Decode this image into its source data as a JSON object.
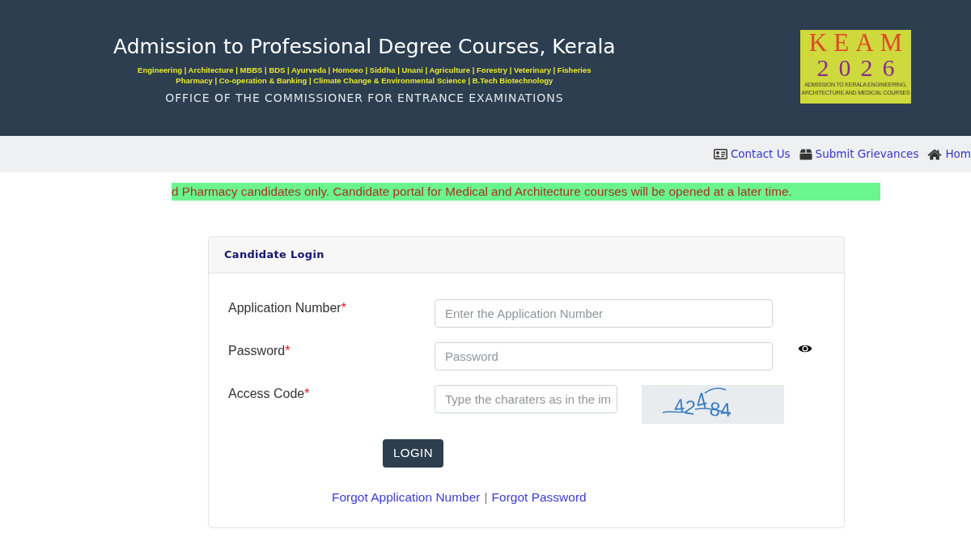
{
  "header": {
    "title": "Admission to Professional Degree Courses, Kerala",
    "course_lines": [
      "Engineering | Architecture | MBBS | BDS | Ayurveda | Homoeo | Siddha | Unani | Agriculture | Forestry | Veterinary | Fisheries",
      "Pharmacy | Co-operation & Banking | Climate Change & Environmental Science | B.Tech Biotechnology"
    ],
    "office": "OFFICE OF THE COMMISSIONER FOR ENTRANCE EXAMINATIONS",
    "logo": {
      "name": "KEAM",
      "year": "2026",
      "caption_lines": [
        "ADMISSION TO KERALA ENGINEERING,",
        "ARCHITECTURE AND MEDICAL COURSES"
      ]
    }
  },
  "nav_links": [
    {
      "label": "Contact Us",
      "kind": "contact"
    },
    {
      "label": "Submit Grievances",
      "kind": "grievance"
    },
    {
      "label": "Hom",
      "kind": "home"
    }
  ],
  "notice": "d Pharmacy candidates only. Candidate portal for Medical and Architecture courses will be opened at a later time.",
  "login": {
    "title": "Candidate Login",
    "fields": [
      {
        "label": "Application Number",
        "required_mark": "*",
        "placeholder": "Enter the Application Number",
        "kind": "text"
      },
      {
        "label": "Password",
        "required_mark": "*",
        "placeholder": "Password",
        "kind": "password"
      },
      {
        "label": "Access Code",
        "required_mark": "*",
        "placeholder": "Type the charaters as in the im",
        "kind": "captcha"
      }
    ],
    "captcha": {
      "code": "42484"
    },
    "button": "LOGIN",
    "links": [
      "Forgot Application Number",
      "Forgot Password"
    ],
    "separator": "|"
  }
}
